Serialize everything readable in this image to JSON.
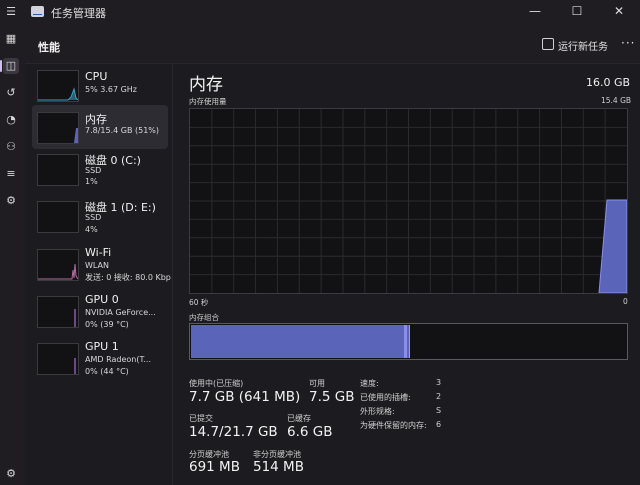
{
  "window": {
    "title": "任务管理器",
    "minimize": "—",
    "maximize": "☐",
    "close": "✕"
  },
  "header": {
    "page_title": "性能",
    "run_task": "运行新任务",
    "more": "···"
  },
  "sidebar": [
    {
      "name": "CPU",
      "sub1": "5% 3.67 GHz",
      "sub2": ""
    },
    {
      "name": "内存",
      "sub1": "7.8/15.4 GB (51%)",
      "sub2": ""
    },
    {
      "name": "磁盘 0 (C:)",
      "sub1": "SSD",
      "sub2": "1%"
    },
    {
      "name": "磁盘 1 (D: E:)",
      "sub1": "SSD",
      "sub2": "4%"
    },
    {
      "name": "Wi-Fi",
      "sub1": "WLAN",
      "sub2": "发送: 0 接收: 80.0 Kbp"
    },
    {
      "name": "GPU 0",
      "sub1": "NVIDIA GeForce...",
      "sub2": "0% (39 °C)"
    },
    {
      "name": "GPU 1",
      "sub1": "AMD Radeon(T...",
      "sub2": "0% (44 °C)"
    }
  ],
  "main": {
    "title": "内存",
    "total": "16.0 GB",
    "usage_label": "内存使用量",
    "usage_max": "15.4 GB",
    "time_left": "60 秒",
    "time_right": "0",
    "composition_label": "内存组合",
    "composition_used_fraction": 0.51,
    "stats": {
      "in_use_label": "使用中(已压缩)",
      "in_use_value": "7.7 GB (641 MB)",
      "available_label": "可用",
      "available_value": "7.5 GB",
      "committed_label": "已提交",
      "committed_value": "14.7/21.7 GB",
      "cached_label": "已缓存",
      "cached_value": "6.6 GB",
      "paged_label": "分页缓冲池",
      "paged_value": "691 MB",
      "nonpaged_label": "非分页缓冲池",
      "nonpaged_value": "514 MB"
    },
    "props": [
      {
        "k": "速度:",
        "v": "3"
      },
      {
        "k": "已使用的插槽:",
        "v": "2"
      },
      {
        "k": "外形规格:",
        "v": "S"
      },
      {
        "k": "为硬件保留的内存:",
        "v": "6"
      }
    ]
  },
  "colors": {
    "accent": "#8b8ee8",
    "fill": "#5a64b8"
  }
}
